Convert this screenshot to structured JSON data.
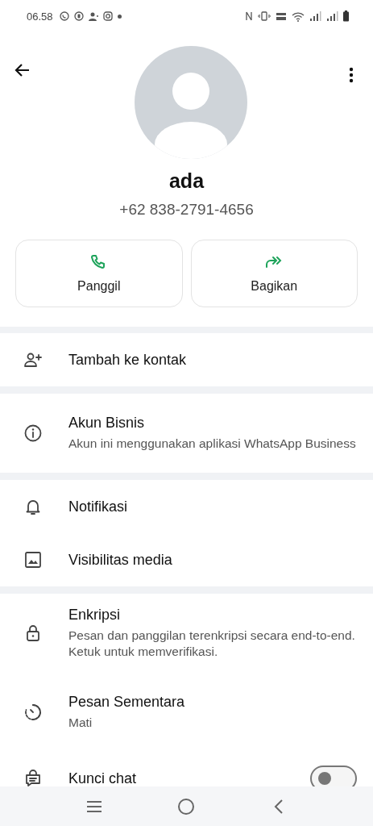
{
  "status_bar": {
    "time": "06.58"
  },
  "contact": {
    "name": "ada",
    "phone": "+62 838-2791-4656"
  },
  "actions": [
    {
      "kind": "call",
      "label": "Panggil"
    },
    {
      "kind": "share",
      "label": "Bagikan"
    }
  ],
  "sections": [
    {
      "items": [
        {
          "kind": "addcontact",
          "title": "Tambah ke kontak"
        }
      ]
    },
    {
      "items": [
        {
          "kind": "info",
          "title": "Akun Bisnis",
          "subtitle": "Akun ini menggunakan aplikasi WhatsApp Business"
        }
      ]
    },
    {
      "items": [
        {
          "kind": "bell",
          "title": "Notifikasi"
        },
        {
          "kind": "image",
          "title": "Visibilitas media"
        }
      ]
    },
    {
      "items": [
        {
          "kind": "lock",
          "title": "Enkripsi",
          "subtitle": "Pesan dan panggilan terenkripsi secara end-to-end. Ketuk untuk memverifikasi."
        },
        {
          "kind": "timer",
          "title": "Pesan Sementara",
          "subtitle": "Mati"
        },
        {
          "kind": "chatlock",
          "title": "Kunci chat",
          "on": false
        }
      ]
    }
  ]
}
